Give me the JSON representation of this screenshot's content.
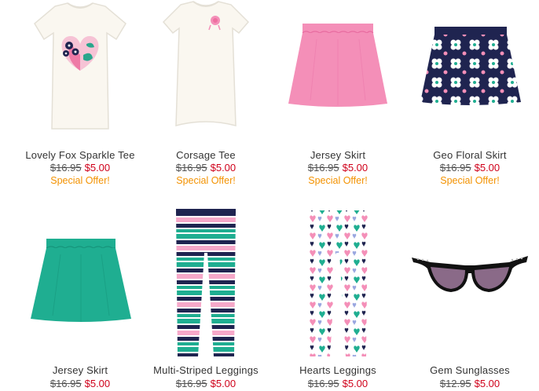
{
  "products": [
    {
      "name": "Lovely Fox Sparkle Tee",
      "old_price": "$16.95",
      "new_price": "$5.00",
      "offer": "Special Offer!",
      "image": "white-tee-heart-graphic"
    },
    {
      "name": "Corsage Tee",
      "old_price": "$16.95",
      "new_price": "$5.00",
      "offer": "Special Offer!",
      "image": "white-tee-pink-corsage"
    },
    {
      "name": "Jersey Skirt",
      "old_price": "$16.95",
      "new_price": "$5.00",
      "offer": "Special Offer!",
      "image": "pink-skirt"
    },
    {
      "name": "Geo Floral Skirt",
      "old_price": "$16.95",
      "new_price": "$5.00",
      "offer": "Special Offer!",
      "image": "navy-floral-skirt"
    },
    {
      "name": "Jersey Skirt",
      "old_price": "$16.95",
      "new_price": "$5.00",
      "image": "teal-skirt"
    },
    {
      "name": "Multi-Striped Leggings",
      "old_price": "$16.95",
      "new_price": "$5.00",
      "image": "striped-leggings"
    },
    {
      "name": "Hearts Leggings",
      "old_price": "$16.95",
      "new_price": "$5.00",
      "image": "hearts-leggings"
    },
    {
      "name": "Gem Sunglasses",
      "old_price": "$12.95",
      "new_price": "$5.00",
      "image": "black-cat-eye-sunglasses"
    }
  ],
  "colors": {
    "sale_price": "#d0021b",
    "special_offer": "#f39200",
    "old_price": "#555555",
    "pink": "#f48fb8",
    "teal": "#1fae91",
    "navy": "#1f2450"
  }
}
